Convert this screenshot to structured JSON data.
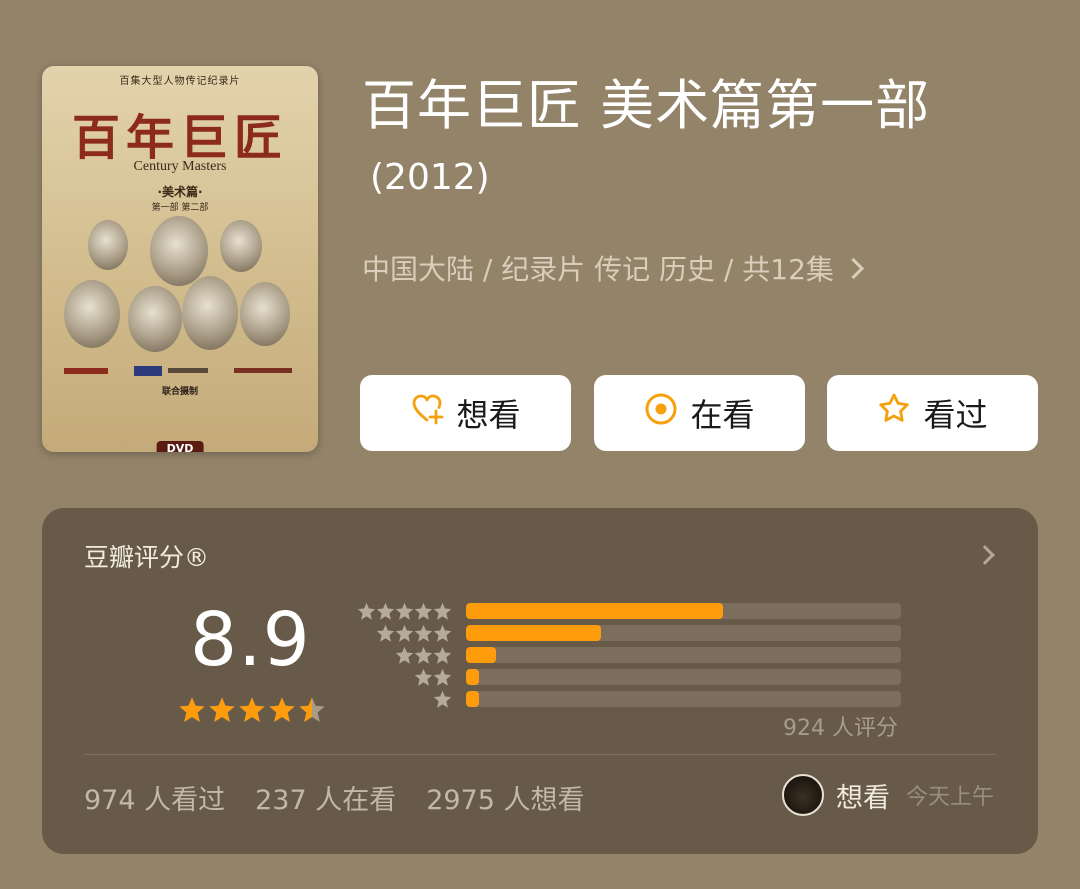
{
  "poster": {
    "top_line": "百集大型人物传记纪录片",
    "title_cn": "百年巨匠",
    "title_en": "Century Masters",
    "sub1": "·美术篇·",
    "sub2": "第一部 第二部",
    "joint": "联合摄制",
    "dvd": "DVD"
  },
  "title": "百年巨匠 美术篇第一部",
  "year": "(2012)",
  "meta": "中国大陆 / 纪录片 传记 历史 / 共12集",
  "actions": [
    {
      "label": "想看",
      "icon": "heart-plus-icon"
    },
    {
      "label": "在看",
      "icon": "target-icon"
    },
    {
      "label": "看过",
      "icon": "star-outline-icon"
    }
  ],
  "rating": {
    "title": "豆瓣评分®",
    "score": "8.9",
    "stars_value": 4.5,
    "distribution": [
      {
        "stars": 5,
        "fraction": 0.59
      },
      {
        "stars": 4,
        "fraction": 0.31
      },
      {
        "stars": 3,
        "fraction": 0.07
      },
      {
        "stars": 2,
        "fraction": 0.03
      },
      {
        "stars": 1,
        "fraction": 0.03
      }
    ],
    "rater_count": "924 人评分",
    "stats": [
      "974 人看过",
      "237 人在看",
      "2975 人想看"
    ],
    "user_status": "想看",
    "user_time": "今天上午"
  },
  "colors": {
    "background": "#928369",
    "card": "#675a48",
    "accent": "#ff9c0c",
    "bar_track": "#7b6e5c"
  }
}
